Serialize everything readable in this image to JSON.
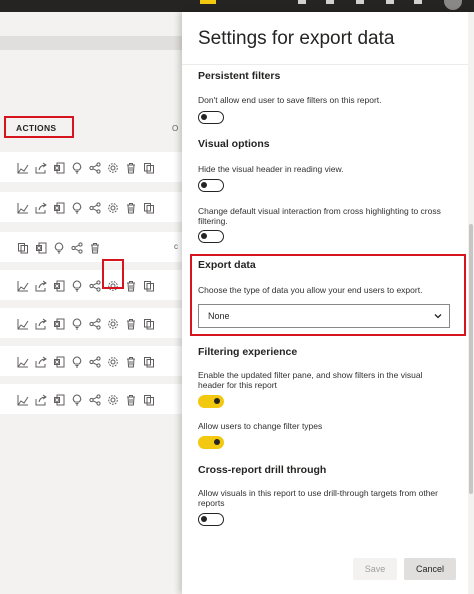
{
  "workspace": {
    "actions_header": "ACTIONS",
    "column_letter": "O",
    "rows": [
      {
        "icons": [
          "analyze-icon",
          "share-icon",
          "excel-icon",
          "insights-icon",
          "lineage-icon",
          "settings-icon",
          "delete-icon",
          "copy-icon"
        ],
        "tail": ""
      },
      {
        "icons": [
          "analyze-icon",
          "share-icon",
          "excel-icon",
          "insights-icon",
          "lineage-icon",
          "settings-icon",
          "delete-icon",
          "copy-icon"
        ],
        "tail": ""
      },
      {
        "icons": [
          "copy-icon",
          "excel-icon",
          "insights-icon",
          "lineage-icon",
          "delete-icon"
        ],
        "tail": "c"
      },
      {
        "icons": [
          "analyze-icon",
          "share-icon",
          "excel-icon",
          "insights-icon",
          "lineage-icon",
          "settings-icon",
          "delete-icon",
          "copy-icon"
        ],
        "tail": ""
      },
      {
        "icons": [
          "analyze-icon",
          "share-icon",
          "excel-icon",
          "insights-icon",
          "lineage-icon",
          "settings-icon",
          "delete-icon",
          "copy-icon"
        ],
        "tail": ""
      },
      {
        "icons": [
          "analyze-icon",
          "share-icon",
          "excel-icon",
          "insights-icon",
          "lineage-icon",
          "settings-icon",
          "delete-icon",
          "copy-icon"
        ],
        "tail": ""
      },
      {
        "icons": [
          "analyze-icon",
          "share-icon",
          "excel-icon",
          "insights-icon",
          "lineage-icon",
          "settings-icon",
          "delete-icon",
          "copy-icon"
        ],
        "tail": ""
      }
    ]
  },
  "panel": {
    "title": "Settings for export data",
    "persistent_filters": {
      "title": "Persistent filters",
      "desc": "Don't allow end user to save filters on this report.",
      "toggle_on": false
    },
    "visual_options": {
      "title": "Visual options",
      "hide_header_desc": "Hide the visual header in reading view.",
      "hide_header_on": false,
      "default_interaction_desc": "Change default visual interaction from cross highlighting to cross filtering.",
      "default_interaction_on": false
    },
    "export_data": {
      "title": "Export data",
      "desc": "Choose the type of data you allow your end users to export.",
      "selected": "None"
    },
    "filtering_experience": {
      "title": "Filtering experience",
      "updated_pane_desc": "Enable the updated filter pane, and show filters in the visual header for this report",
      "updated_pane_on": true,
      "filter_types_desc": "Allow users to change filter types",
      "filter_types_on": true
    },
    "cross_report": {
      "title": "Cross-report drill through",
      "desc": "Allow visuals in this report to use drill-through targets from other reports",
      "toggle_on": false
    },
    "save_label": "Save",
    "cancel_label": "Cancel"
  },
  "colors": {
    "accent_yellow": "#f2c811",
    "highlight_red": "#d6141e",
    "topbar": "#252423"
  }
}
